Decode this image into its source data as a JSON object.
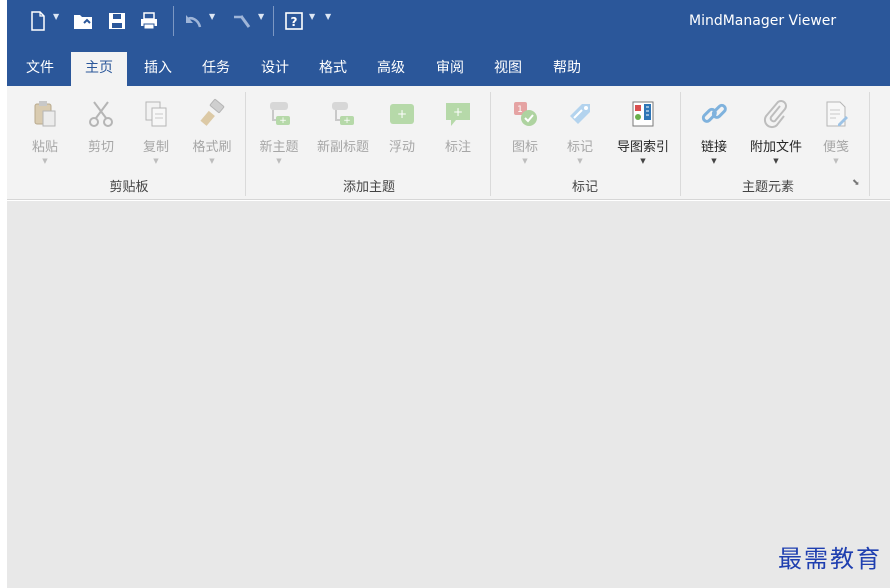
{
  "app": {
    "title": "MindManager Viewer"
  },
  "quick_access": [
    "new-document-icon",
    "open-file-icon",
    "save-icon",
    "print-icon",
    "undo-icon",
    "redo-icon",
    "help-icon"
  ],
  "tabs": [
    {
      "label": "文件"
    },
    {
      "label": "主页",
      "active": true
    },
    {
      "label": "插入"
    },
    {
      "label": "任务"
    },
    {
      "label": "设计"
    },
    {
      "label": "格式"
    },
    {
      "label": "高级"
    },
    {
      "label": "审阅"
    },
    {
      "label": "视图"
    },
    {
      "label": "帮助"
    }
  ],
  "ribbon": {
    "groups": [
      {
        "label": "剪贴板",
        "buttons": [
          {
            "label": "粘贴",
            "enabled": false,
            "icon": "paste-icon"
          },
          {
            "label": "剪切",
            "enabled": false,
            "icon": "cut-icon"
          },
          {
            "label": "复制",
            "enabled": false,
            "icon": "copy-icon"
          },
          {
            "label": "格式刷",
            "enabled": false,
            "icon": "format-painter-icon"
          }
        ]
      },
      {
        "label": "添加主题",
        "buttons": [
          {
            "label": "新主题",
            "enabled": false,
            "icon": "new-topic-icon"
          },
          {
            "label": "新副标题",
            "enabled": false,
            "icon": "new-subtopic-icon"
          },
          {
            "label": "浮动",
            "enabled": false,
            "icon": "floating-topic-icon"
          },
          {
            "label": "标注",
            "enabled": false,
            "icon": "callout-icon"
          }
        ]
      },
      {
        "label": "标记",
        "buttons": [
          {
            "label": "图标",
            "enabled": false,
            "icon": "marker-icon"
          },
          {
            "label": "标记",
            "enabled": false,
            "icon": "tag-icon"
          },
          {
            "label": "导图索引",
            "enabled": true,
            "icon": "map-index-icon"
          }
        ]
      },
      {
        "label": "主题元素",
        "buttons": [
          {
            "label": "链接",
            "enabled": true,
            "icon": "link-icon"
          },
          {
            "label": "附加文件",
            "enabled": true,
            "icon": "attachment-icon"
          },
          {
            "label": "便笺",
            "enabled": false,
            "icon": "note-icon"
          }
        ]
      }
    ]
  },
  "watermark": {
    "text": "最需教育"
  },
  "colors": {
    "title_bar": "#2b579a",
    "ribbon_bg": "#f3f3f3",
    "workspace_bg": "#e8e8e8",
    "watermark": "#1f3fb0"
  }
}
